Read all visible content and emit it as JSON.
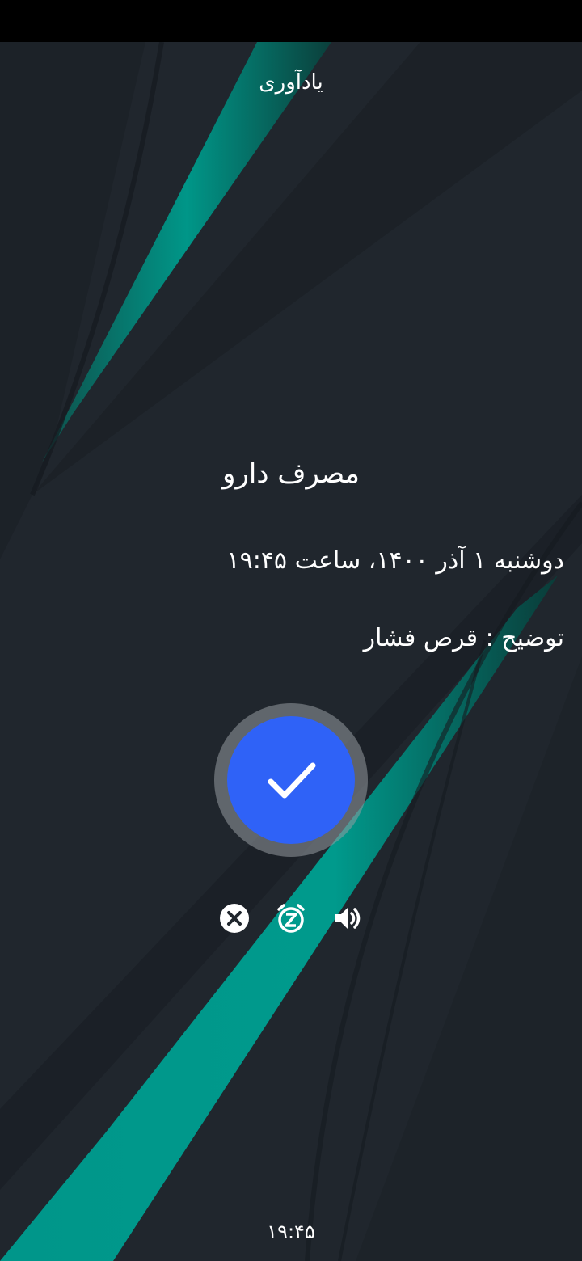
{
  "header": {
    "title": "یادآوری"
  },
  "reminder": {
    "title": "مصرف دارو",
    "datetime": "دوشنبه ۱ آذر ۱۴۰۰، ساعت ۱۹:۴۵",
    "description": "توضیح : قرص فشار"
  },
  "actions": {
    "confirm_icon": "check-icon",
    "dismiss_icon": "close-circle-icon",
    "snooze_icon": "snooze-alarm-icon",
    "sound_icon": "volume-icon"
  },
  "footer": {
    "time": "۱۹:۴۵"
  },
  "colors": {
    "background": "#20262d",
    "accent_teal": "#00968a",
    "confirm_blue": "#2f62f7"
  }
}
